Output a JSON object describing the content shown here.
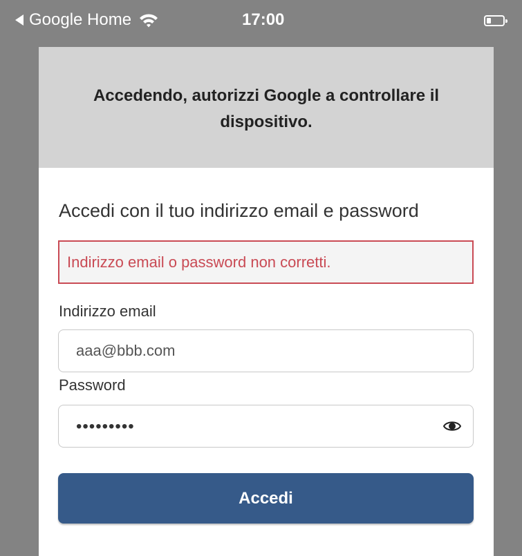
{
  "status_bar": {
    "back_app": "Google Home",
    "time": "17:00",
    "icons": [
      "back-arrow-icon",
      "wifi-icon",
      "battery-icon"
    ]
  },
  "header": {
    "message": "Accedendo, autorizzi Google a controllare il dispositivo."
  },
  "form": {
    "title": "Accedi con il tuo indirizzo email e password",
    "error": "Indirizzo email o password non corretti.",
    "email_label": "Indirizzo email",
    "email_value": "aaa@bbb.com",
    "password_label": "Password",
    "password_value": "•••••••••",
    "password_toggle_icon": "eye-icon",
    "submit_label": "Accedi"
  },
  "colors": {
    "background": "#838383",
    "header_bg": "#d3d3d3",
    "error": "#c94a54",
    "button": "#365a89"
  }
}
